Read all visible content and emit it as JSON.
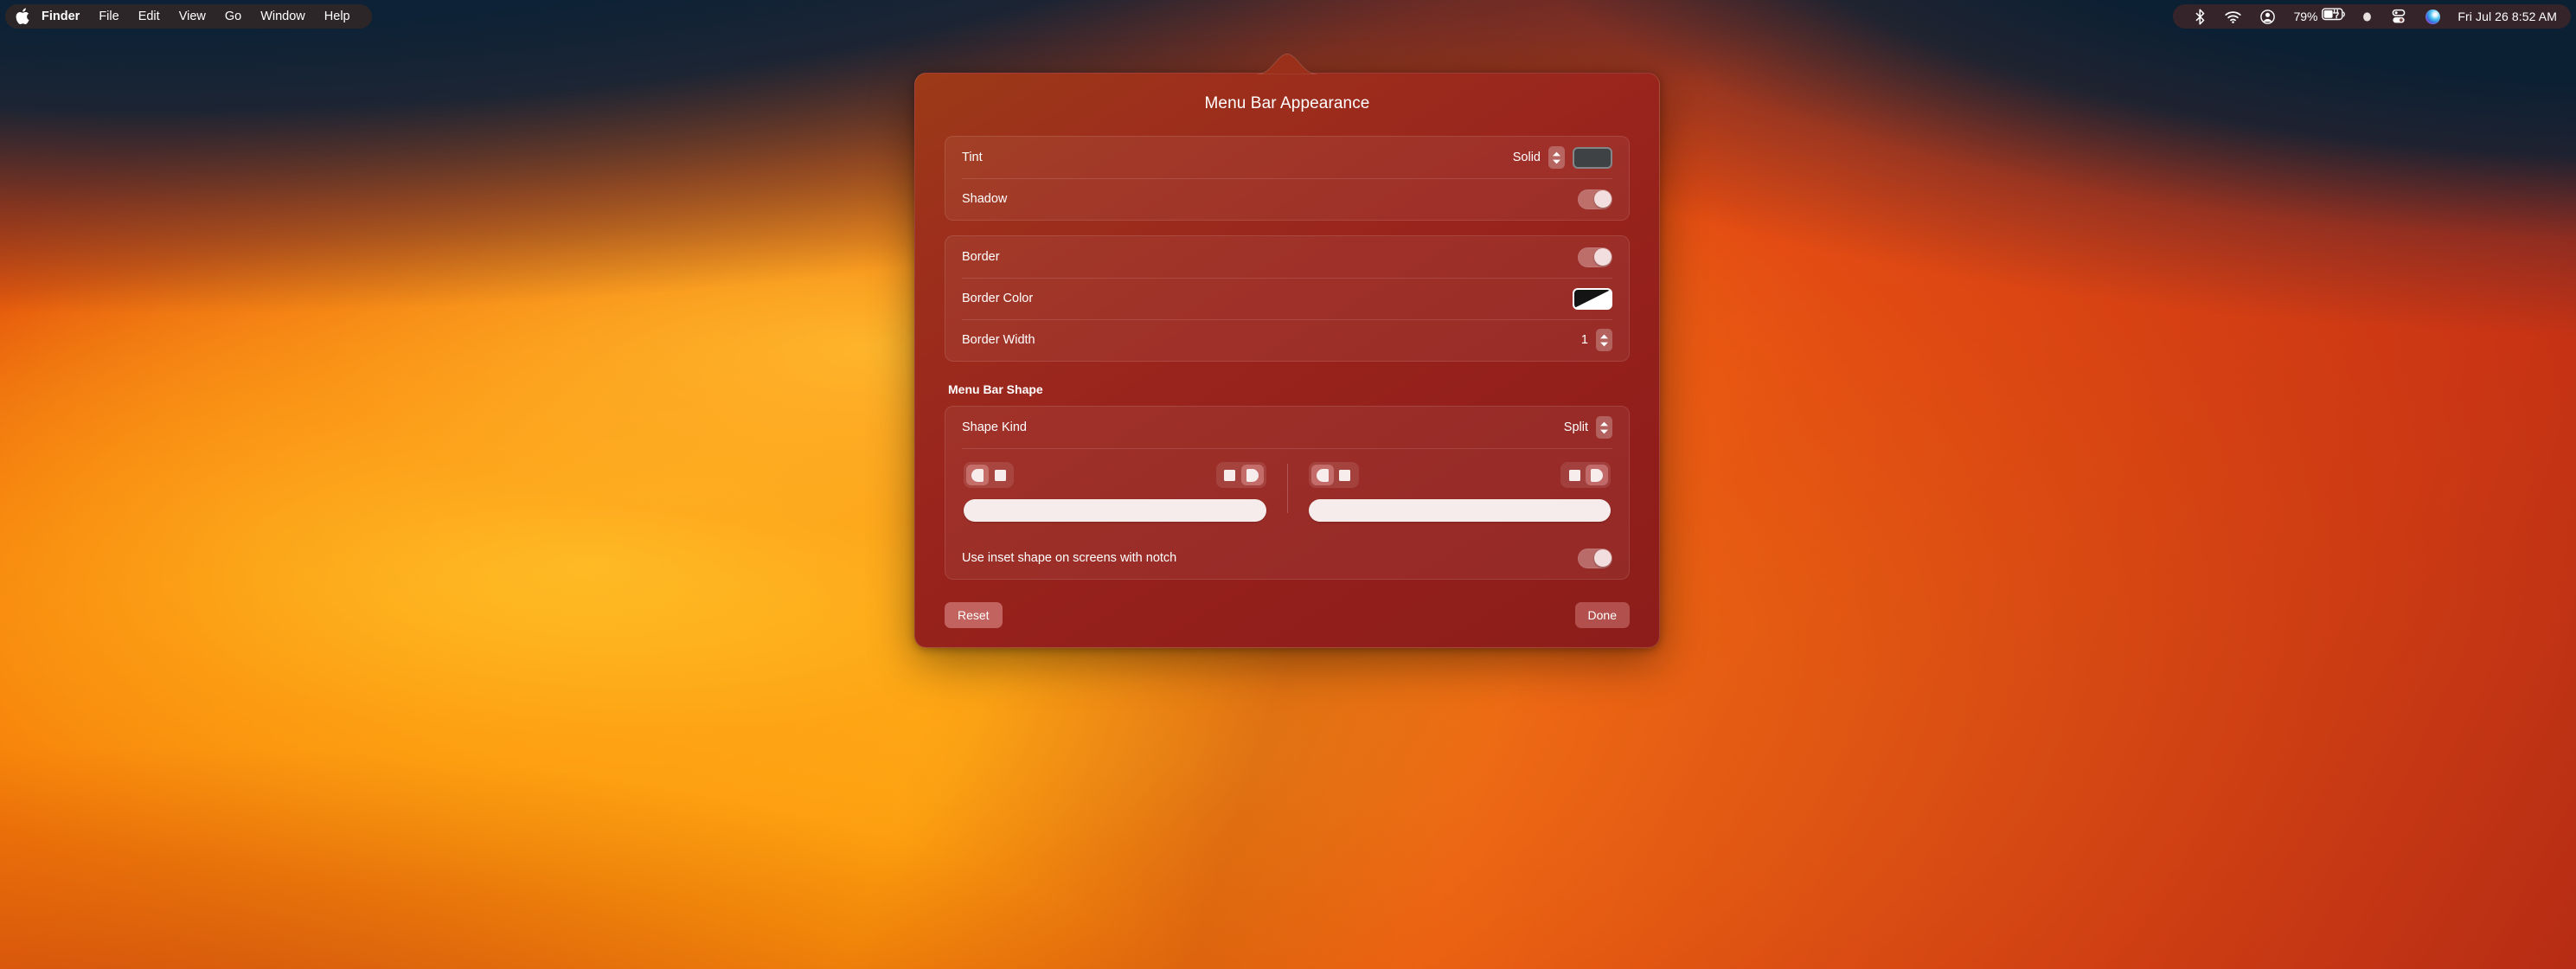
{
  "menubar": {
    "apple_icon": "apple-logo-icon",
    "app_items": [
      {
        "label": "Finder",
        "bold": true
      },
      {
        "label": "File",
        "bold": false
      },
      {
        "label": "Edit",
        "bold": false
      },
      {
        "label": "View",
        "bold": false
      },
      {
        "label": "Go",
        "bold": false
      },
      {
        "label": "Window",
        "bold": false
      },
      {
        "label": "Help",
        "bold": false
      }
    ],
    "status": {
      "bluetooth_icon": "bluetooth-icon",
      "wifi_icon": "wifi-icon",
      "account_icon": "user-account-icon",
      "battery_percent": "79%",
      "battery_icon": "battery-charging-icon",
      "dot_icon": "recording-dot-icon",
      "control_center_icon": "control-center-icon",
      "siri_icon": "siri-orb-icon",
      "clock": "Fri Jul 26  8:52 AM"
    }
  },
  "popover": {
    "title": "Menu Bar Appearance",
    "groups": [
      {
        "rows": [
          {
            "label": "Tint",
            "value": "Solid",
            "control": "menu-swatch",
            "swatch_color": "#3e4245"
          },
          {
            "label": "Shadow",
            "control": "toggle",
            "toggle_on": true
          }
        ]
      },
      {
        "rows": [
          {
            "label": "Border",
            "control": "toggle",
            "toggle_on": true
          },
          {
            "label": "Border Color",
            "control": "swatch-split"
          },
          {
            "label": "Border Width",
            "value": "1",
            "control": "stepper"
          }
        ]
      }
    ],
    "shape_section": {
      "heading": "Menu Bar Shape",
      "shape_kind_label": "Shape Kind",
      "shape_kind_value": "Split",
      "halves": [
        {
          "name": "leading-half",
          "leading_segment": {
            "options": [
              "round-left",
              "square"
            ],
            "selected": 0
          },
          "trailing_segment": {
            "options": [
              "square",
              "round-right"
            ],
            "selected": 1
          }
        },
        {
          "name": "trailing-half",
          "leading_segment": {
            "options": [
              "round-left",
              "square"
            ],
            "selected": 0
          },
          "trailing_segment": {
            "options": [
              "square",
              "round-right"
            ],
            "selected": 1
          }
        }
      ],
      "inset_label": "Use inset shape on screens with notch",
      "inset_toggle_on": true
    },
    "footer": {
      "reset_label": "Reset",
      "done_label": "Done"
    }
  },
  "colors": {
    "popover_tint": "#99241d",
    "accent_pink": "#ffbebc",
    "menubar_tint": "#3a2822"
  }
}
